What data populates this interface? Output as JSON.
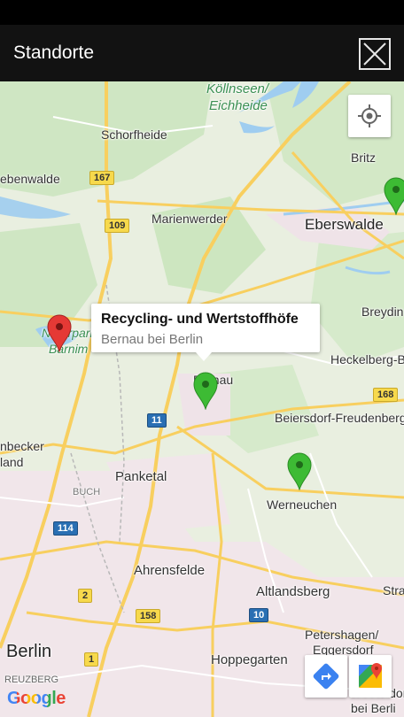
{
  "app": {
    "title": "Standorte"
  },
  "map": {
    "places": {
      "koellnseen": "Köllnseen/",
      "eichheide": "Eichheide",
      "schorfheide": "Schorfheide",
      "ebenwalde": "ebenwalde",
      "britz": "Britz",
      "marienwerder": "Marienwerder",
      "eberswalde": "Eberswalde",
      "breydin": "Breydin",
      "heckelberg": "Heckelberg-B",
      "bernau": "Bernau",
      "naturpark": "Naturpark",
      "barnim": "Barnim",
      "beiersdorf": "Beiersdorf-Freudenberg",
      "nbecker": "nbecker",
      "land": "land",
      "panketal": "Panketal",
      "buch": "BUCH",
      "werneuchen": "Werneuchen",
      "ahrensfelde": "Ahrensfelde",
      "stra": "Stra",
      "altlandsberg": "Altlandsberg",
      "petershagen": "Petershagen/",
      "eggersdorf": "Eggersdorf",
      "berlin": "Berlin",
      "hoppegarten": "Hoppegarten",
      "kreuzberg": "REUZBERG",
      "rudersdorf": "Rüdersdorf",
      "beiberli": "bei Berli"
    },
    "shields": {
      "r167": "167",
      "r109": "109",
      "r168": "168",
      "r11": "11",
      "r114": "114",
      "r2": "2",
      "r158": "158",
      "r10": "10",
      "r1": "1"
    },
    "info_window": {
      "title": "Recycling- und Wertstoffhöfe",
      "subtitle": "Bernau bei Berlin"
    },
    "logo": "Google",
    "colors": {
      "pin_selected": "#e53935",
      "pin_other": "#3dbb34",
      "water": "#9fcdf0",
      "forest": "#cde6c0",
      "urban": "#f1e6ea",
      "road_major": "#f8cf5f"
    }
  }
}
